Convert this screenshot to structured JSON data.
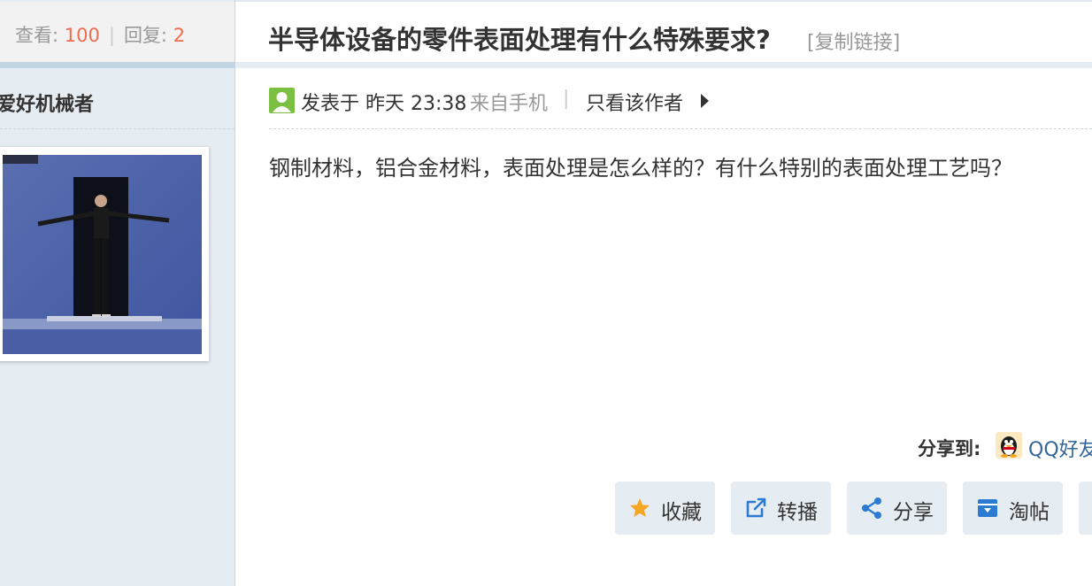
{
  "sidebar": {
    "stats": {
      "views_label": "查看:",
      "views": "100",
      "separator": "|",
      "replies_label": "回复:",
      "replies": "2"
    },
    "author_name": "爱好机械者",
    "avatar_icon": "user-avatar-photo"
  },
  "post": {
    "title": "半导体设备的零件表面处理有什么特殊要求?",
    "copy_link": "[复制链接]",
    "meta": {
      "posted": "发表于 昨天 23:38",
      "from": "来自手机",
      "separator": "|",
      "only_author": "只看该作者"
    },
    "content": "钢制材料，铝合金材料，表面处理是怎么样的？有什么特别的表面处理工艺吗？"
  },
  "share": {
    "label": "分享到:",
    "qq_label": "QQ好友"
  },
  "actions": [
    {
      "label": "收藏",
      "icon": "star-icon"
    },
    {
      "label": "转播",
      "icon": "external-link-icon"
    },
    {
      "label": "分享",
      "icon": "share-icon"
    },
    {
      "label": "淘帖",
      "icon": "archive-box-icon"
    }
  ],
  "colors": {
    "accent": "#f26c4f",
    "sidebar_bg": "#e5edf2",
    "divider": "#c2d5e3",
    "link": "#336699"
  }
}
